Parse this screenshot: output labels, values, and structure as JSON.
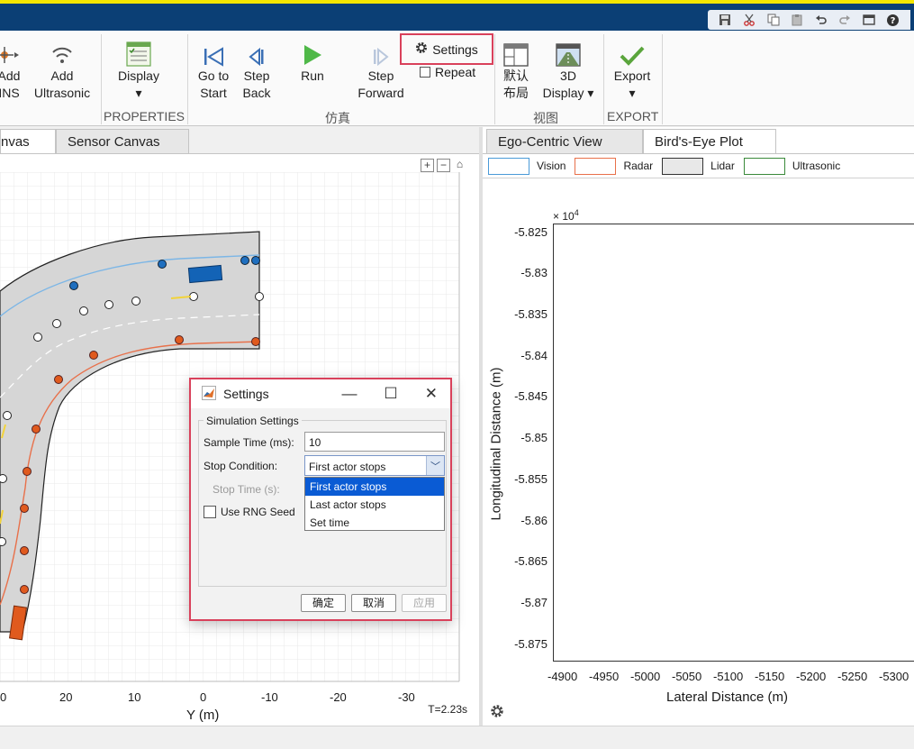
{
  "toolstrip": {
    "add_ins_label": "Add\nINS",
    "add_ultrasonic_label": "Add\nUltrasonic",
    "display_label": "Display",
    "properties_section": "PROPERTIES",
    "go_to_start_label": "Go to\nStart",
    "step_back_label": "Step\nBack",
    "run_label": "Run",
    "step_forward_label": "Step\nForward",
    "settings_label": "Settings",
    "repeat_label": "Repeat",
    "simulation_section": "仿真",
    "default_layout_label": "默认\n布局",
    "display_3d_label": "3D\nDisplay ▾",
    "view_section": "视图",
    "export_label": "Export",
    "export_section": "EXPORT"
  },
  "left_tabs": [
    "nvas",
    "Sensor Canvas"
  ],
  "right_tabs": [
    "Ego-Centric View",
    "Bird's-Eye Plot"
  ],
  "legend": [
    {
      "label": "Vision",
      "color": "#4a9ad8"
    },
    {
      "label": "Radar",
      "color": "#e8704a"
    },
    {
      "label": "Lidar",
      "color": "#333333"
    },
    {
      "label": "Ultrasonic",
      "color": "#3a8a3a"
    }
  ],
  "scenario_canvas": {
    "x_axis_label": "Y (m)",
    "x_ticks": [
      "0",
      "20",
      "10",
      "0",
      "-10",
      "-20",
      "-30"
    ],
    "time_label": "T=2.23s"
  },
  "birds_eye_plot": {
    "ylabel": "Longitudinal Distance (m)",
    "xlabel": "Lateral Distance (m)",
    "exponent": "× 10",
    "exponent_power": "4",
    "y_ticks": [
      "-5.825",
      "-5.83",
      "-5.835",
      "-5.84",
      "-5.845",
      "-5.85",
      "-5.855",
      "-5.86",
      "-5.865",
      "-5.87",
      "-5.875"
    ],
    "x_ticks": [
      "-4900",
      "-4950",
      "-5000",
      "-5050",
      "-5100",
      "-5150",
      "-5200",
      "-5250",
      "-5300"
    ]
  },
  "dialog": {
    "title": "Settings",
    "group_title": "Simulation Settings",
    "sample_time_label": "Sample Time (ms):",
    "sample_time_value": "10",
    "stop_condition_label": "Stop Condition:",
    "stop_condition_value": "First actor stops",
    "stop_time_label": "Stop Time (s):",
    "options": [
      "First actor stops",
      "Last actor stops",
      "Set time"
    ],
    "rng_label": "Use RNG Seed",
    "ok_label": "确定",
    "cancel_label": "取消",
    "apply_label": "应用"
  }
}
